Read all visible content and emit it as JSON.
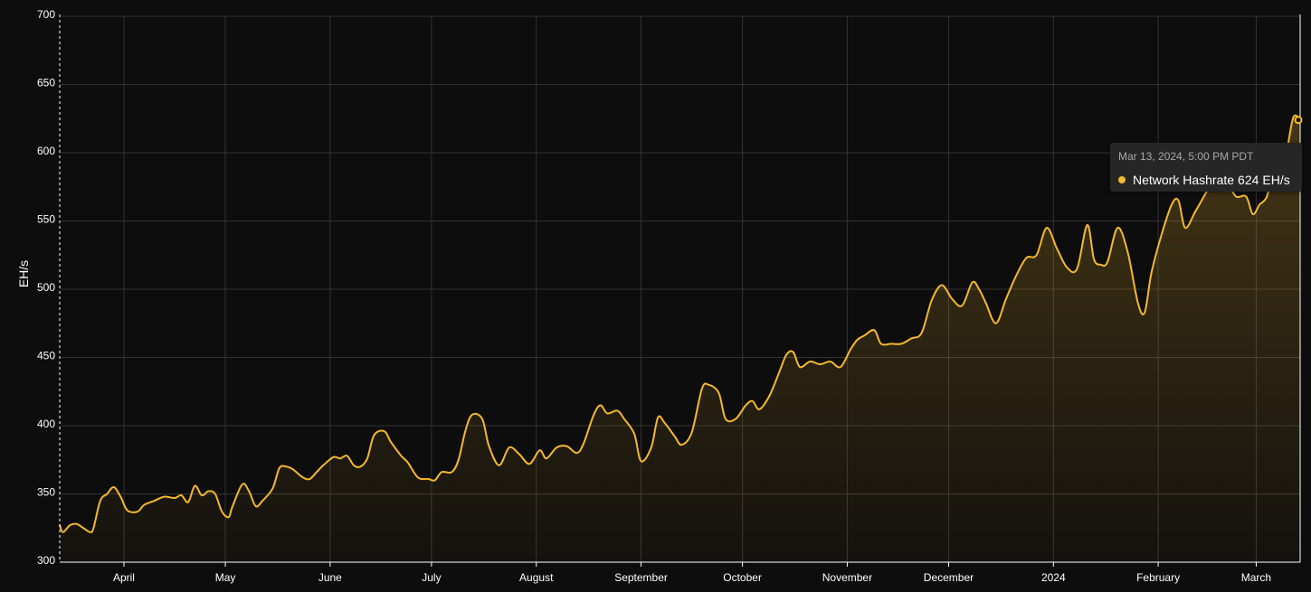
{
  "colors": {
    "background": "#0d0d0d",
    "grid": "#333333",
    "axis": "#ffffff",
    "series": "#f5b82e"
  },
  "tooltip": {
    "date": "Mar 13, 2024, 5:00 PM PDT",
    "series_name": "Network Hashrate",
    "value": "624",
    "unit": "EH/s"
  },
  "chart_data": {
    "type": "area",
    "ylabel": "EH/s",
    "ylim": [
      300,
      700
    ],
    "yticks": [
      300,
      350,
      400,
      450,
      500,
      550,
      600,
      650,
      700
    ],
    "xlim": [
      "2023-03-13",
      "2024-03-14"
    ],
    "xticks": [
      {
        "date": "2023-04-01",
        "label": "April"
      },
      {
        "date": "2023-05-01",
        "label": "May"
      },
      {
        "date": "2023-06-01",
        "label": "June"
      },
      {
        "date": "2023-07-01",
        "label": "July"
      },
      {
        "date": "2023-08-01",
        "label": "August"
      },
      {
        "date": "2023-09-01",
        "label": "September"
      },
      {
        "date": "2023-10-01",
        "label": "October"
      },
      {
        "date": "2023-11-01",
        "label": "November"
      },
      {
        "date": "2023-12-01",
        "label": "December"
      },
      {
        "date": "2024-01-01",
        "label": "2024"
      },
      {
        "date": "2024-02-01",
        "label": "February"
      },
      {
        "date": "2024-03-01",
        "label": "March"
      }
    ],
    "grid": true,
    "legend": "none",
    "series": [
      {
        "name": "Network Hashrate",
        "points": [
          [
            "2023-03-13",
            327
          ],
          [
            "2023-03-14",
            322
          ],
          [
            "2023-03-16",
            327
          ],
          [
            "2023-03-18",
            328
          ],
          [
            "2023-03-20",
            325
          ],
          [
            "2023-03-22",
            322
          ],
          [
            "2023-03-23",
            325
          ],
          [
            "2023-03-25",
            345
          ],
          [
            "2023-03-27",
            350
          ],
          [
            "2023-03-29",
            355
          ],
          [
            "2023-03-31",
            348
          ],
          [
            "2023-04-02",
            338
          ],
          [
            "2023-04-05",
            337
          ],
          [
            "2023-04-07",
            342
          ],
          [
            "2023-04-10",
            345
          ],
          [
            "2023-04-13",
            348
          ],
          [
            "2023-04-16",
            347
          ],
          [
            "2023-04-18",
            349
          ],
          [
            "2023-04-20",
            344
          ],
          [
            "2023-04-22",
            356
          ],
          [
            "2023-04-24",
            349
          ],
          [
            "2023-04-26",
            352
          ],
          [
            "2023-04-28",
            350
          ],
          [
            "2023-04-30",
            337
          ],
          [
            "2023-05-02",
            333
          ],
          [
            "2023-05-03",
            340
          ],
          [
            "2023-05-06",
            357
          ],
          [
            "2023-05-08",
            352
          ],
          [
            "2023-05-10",
            341
          ],
          [
            "2023-05-12",
            345
          ],
          [
            "2023-05-15",
            354
          ],
          [
            "2023-05-17",
            369
          ],
          [
            "2023-05-19",
            370
          ],
          [
            "2023-05-21",
            368
          ],
          [
            "2023-05-24",
            362
          ],
          [
            "2023-05-26",
            361
          ],
          [
            "2023-05-28",
            366
          ],
          [
            "2023-05-30",
            371
          ],
          [
            "2023-06-02",
            377
          ],
          [
            "2023-06-04",
            376
          ],
          [
            "2023-06-06",
            378
          ],
          [
            "2023-06-08",
            371
          ],
          [
            "2023-06-10",
            370
          ],
          [
            "2023-06-12",
            376
          ],
          [
            "2023-06-14",
            393
          ],
          [
            "2023-06-17",
            396
          ],
          [
            "2023-06-19",
            388
          ],
          [
            "2023-06-22",
            378
          ],
          [
            "2023-06-24",
            373
          ],
          [
            "2023-06-27",
            362
          ],
          [
            "2023-06-30",
            361
          ],
          [
            "2023-07-02",
            360
          ],
          [
            "2023-07-04",
            366
          ],
          [
            "2023-07-07",
            366
          ],
          [
            "2023-07-09",
            375
          ],
          [
            "2023-07-11",
            396
          ],
          [
            "2023-07-13",
            408
          ],
          [
            "2023-07-16",
            405
          ],
          [
            "2023-07-18",
            385
          ],
          [
            "2023-07-21",
            371
          ],
          [
            "2023-07-24",
            384
          ],
          [
            "2023-07-27",
            379
          ],
          [
            "2023-07-30",
            372
          ],
          [
            "2023-08-02",
            382
          ],
          [
            "2023-08-04",
            376
          ],
          [
            "2023-08-07",
            384
          ],
          [
            "2023-08-10",
            385
          ],
          [
            "2023-08-13",
            380
          ],
          [
            "2023-08-15",
            387
          ],
          [
            "2023-08-18",
            408
          ],
          [
            "2023-08-20",
            415
          ],
          [
            "2023-08-22",
            409
          ],
          [
            "2023-08-25",
            411
          ],
          [
            "2023-08-27",
            405
          ],
          [
            "2023-08-30",
            394
          ],
          [
            "2023-09-01",
            374
          ],
          [
            "2023-09-04",
            384
          ],
          [
            "2023-09-06",
            406
          ],
          [
            "2023-09-08",
            402
          ],
          [
            "2023-09-11",
            392
          ],
          [
            "2023-09-13",
            386
          ],
          [
            "2023-09-16",
            395
          ],
          [
            "2023-09-19",
            427
          ],
          [
            "2023-09-21",
            430
          ],
          [
            "2023-09-24",
            424
          ],
          [
            "2023-09-26",
            405
          ],
          [
            "2023-09-29",
            405
          ],
          [
            "2023-10-02",
            415
          ],
          [
            "2023-10-04",
            418
          ],
          [
            "2023-10-06",
            412
          ],
          [
            "2023-10-09",
            422
          ],
          [
            "2023-10-12",
            440
          ],
          [
            "2023-10-14",
            452
          ],
          [
            "2023-10-16",
            454
          ],
          [
            "2023-10-18",
            443
          ],
          [
            "2023-10-21",
            447
          ],
          [
            "2023-10-24",
            445
          ],
          [
            "2023-10-27",
            447
          ],
          [
            "2023-10-30",
            443
          ],
          [
            "2023-11-02",
            456
          ],
          [
            "2023-11-04",
            463
          ],
          [
            "2023-11-06",
            466
          ],
          [
            "2023-11-09",
            470
          ],
          [
            "2023-11-11",
            460
          ],
          [
            "2023-11-14",
            460
          ],
          [
            "2023-11-17",
            460
          ],
          [
            "2023-11-20",
            464
          ],
          [
            "2023-11-23",
            468
          ],
          [
            "2023-11-26",
            492
          ],
          [
            "2023-11-29",
            503
          ],
          [
            "2023-12-02",
            493
          ],
          [
            "2023-12-05",
            488
          ],
          [
            "2023-12-08",
            505
          ],
          [
            "2023-12-10",
            500
          ],
          [
            "2023-12-12",
            490
          ],
          [
            "2023-12-15",
            475
          ],
          [
            "2023-12-18",
            493
          ],
          [
            "2023-12-21",
            510
          ],
          [
            "2023-12-24",
            523
          ],
          [
            "2023-12-27",
            525
          ],
          [
            "2023-12-30",
            545
          ],
          [
            "2024-01-02",
            530
          ],
          [
            "2024-01-05",
            516
          ],
          [
            "2024-01-08",
            515
          ],
          [
            "2024-01-11",
            547
          ],
          [
            "2024-01-13",
            522
          ],
          [
            "2024-01-15",
            518
          ],
          [
            "2024-01-17",
            520
          ],
          [
            "2024-01-20",
            545
          ],
          [
            "2024-01-23",
            527
          ],
          [
            "2024-01-26",
            490
          ],
          [
            "2024-01-28",
            483
          ],
          [
            "2024-01-30",
            512
          ],
          [
            "2024-02-02",
            540
          ],
          [
            "2024-02-05",
            562
          ],
          [
            "2024-02-07",
            565
          ],
          [
            "2024-02-09",
            545
          ],
          [
            "2024-02-12",
            557
          ],
          [
            "2024-02-15",
            570
          ],
          [
            "2024-02-18",
            583
          ],
          [
            "2024-02-21",
            580
          ],
          [
            "2024-02-24",
            568
          ],
          [
            "2024-02-27",
            568
          ],
          [
            "2024-02-29",
            555
          ],
          [
            "2024-03-02",
            562
          ],
          [
            "2024-03-04",
            567
          ],
          [
            "2024-03-06",
            582
          ],
          [
            "2024-03-08",
            575
          ],
          [
            "2024-03-10",
            600
          ],
          [
            "2024-03-12",
            626
          ],
          [
            "2024-03-14",
            624
          ]
        ]
      }
    ]
  }
}
